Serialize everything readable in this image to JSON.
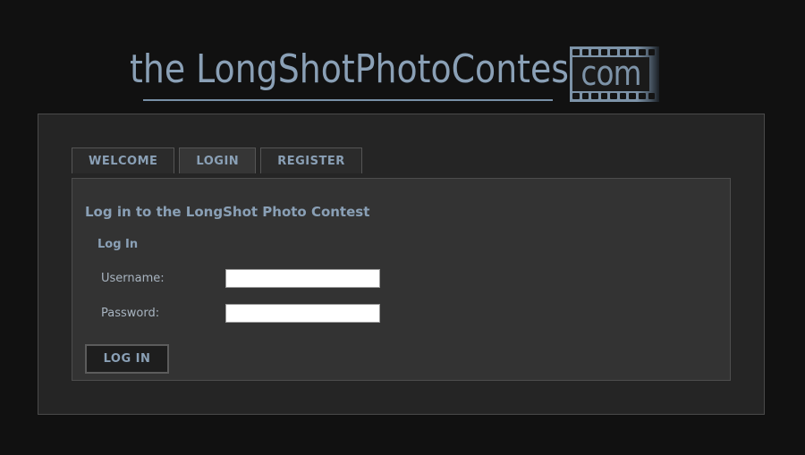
{
  "header": {
    "logo_text": "the LongShotPhotoContest",
    "logo_suffix": "com"
  },
  "tabs": [
    {
      "label": "WELCOME",
      "active": false
    },
    {
      "label": "LOGIN",
      "active": true
    },
    {
      "label": "REGISTER",
      "active": false
    }
  ],
  "login_panel": {
    "title": "Log in to the LongShot Photo Contest",
    "section_title": "Log In",
    "username_label": "Username:",
    "username_value": "",
    "password_label": "Password:",
    "password_value": "",
    "submit_label": "LOG IN"
  },
  "colors": {
    "background": "#111111",
    "panel": "#252525",
    "inner_panel": "#333333",
    "accent_text": "#8aa0b6"
  }
}
